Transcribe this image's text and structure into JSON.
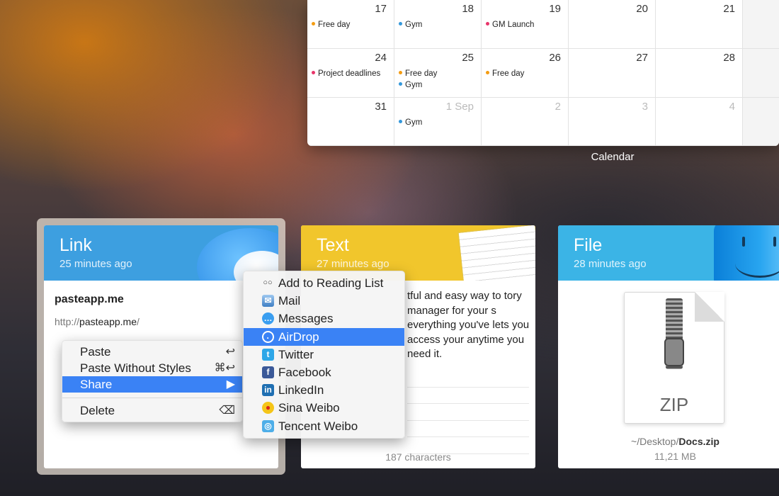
{
  "calendar": {
    "caption": "Calendar",
    "weeks": [
      [
        {
          "date": "17",
          "events": [
            {
              "label": "Free day",
              "color": "#f39c12"
            }
          ]
        },
        {
          "date": "18",
          "events": [
            {
              "label": "Gym",
              "color": "#3498db"
            }
          ]
        },
        {
          "date": "19",
          "events": [
            {
              "label": "GM Launch",
              "color": "#e8356a"
            }
          ]
        },
        {
          "date": "20",
          "events": []
        },
        {
          "date": "21",
          "events": []
        },
        {
          "date": "",
          "events": []
        }
      ],
      [
        {
          "date": "24",
          "events": [
            {
              "label": "Project deadlines",
              "color": "#e8356a"
            }
          ]
        },
        {
          "date": "25",
          "events": [
            {
              "label": "Free day",
              "color": "#f39c12"
            },
            {
              "label": "Gym",
              "color": "#3498db"
            }
          ]
        },
        {
          "date": "26",
          "events": [
            {
              "label": "Free day",
              "color": "#f39c12"
            }
          ]
        },
        {
          "date": "27",
          "events": []
        },
        {
          "date": "28",
          "events": []
        },
        {
          "date": "",
          "events": []
        }
      ],
      [
        {
          "date": "31",
          "events": []
        },
        {
          "date": "1 Sep",
          "muted": true,
          "events": [
            {
              "label": "Gym",
              "color": "#3498db"
            }
          ]
        },
        {
          "date": "2",
          "muted": true,
          "events": []
        },
        {
          "date": "3",
          "muted": true,
          "events": []
        },
        {
          "date": "4",
          "muted": true,
          "events": []
        },
        {
          "date": "",
          "events": []
        }
      ]
    ]
  },
  "link_card": {
    "title": "Link",
    "time": "25 minutes ago",
    "name": "pasteapp.me",
    "url_prefix": "http://",
    "url_domain": "pasteapp.me",
    "url_suffix": "/"
  },
  "text_card": {
    "title": "Text",
    "time": "27 minutes ago",
    "body": "tful and easy way to tory manager for your s everything you've lets you access your anytime you need it.",
    "footer": "187 characters"
  },
  "file_card": {
    "title": "File",
    "time": "28 minutes ago",
    "icon_label": "ZIP",
    "path_prefix": "~/Desktop/",
    "path_file": "Docs.zip",
    "size": "11,21 MB"
  },
  "context_menu": {
    "items": [
      {
        "label": "Paste",
        "shortcut": "↩"
      },
      {
        "label": "Paste Without Styles",
        "shortcut": "⌘↩"
      },
      {
        "label": "Share",
        "shortcut": "▶"
      },
      {
        "label": "Delete",
        "shortcut": "⌫"
      }
    ]
  },
  "share_menu": {
    "items": [
      {
        "label": "Add to Reading List",
        "icon": "reading-list-icon"
      },
      {
        "label": "Mail",
        "icon": "mail-icon"
      },
      {
        "label": "Messages",
        "icon": "messages-icon"
      },
      {
        "label": "AirDrop",
        "icon": "airdrop-icon"
      },
      {
        "label": "Twitter",
        "icon": "twitter-icon"
      },
      {
        "label": "Facebook",
        "icon": "facebook-icon"
      },
      {
        "label": "LinkedIn",
        "icon": "linkedin-icon"
      },
      {
        "label": "Sina Weibo",
        "icon": "sina-weibo-icon"
      },
      {
        "label": "Tencent Weibo",
        "icon": "tencent-weibo-icon"
      }
    ]
  }
}
